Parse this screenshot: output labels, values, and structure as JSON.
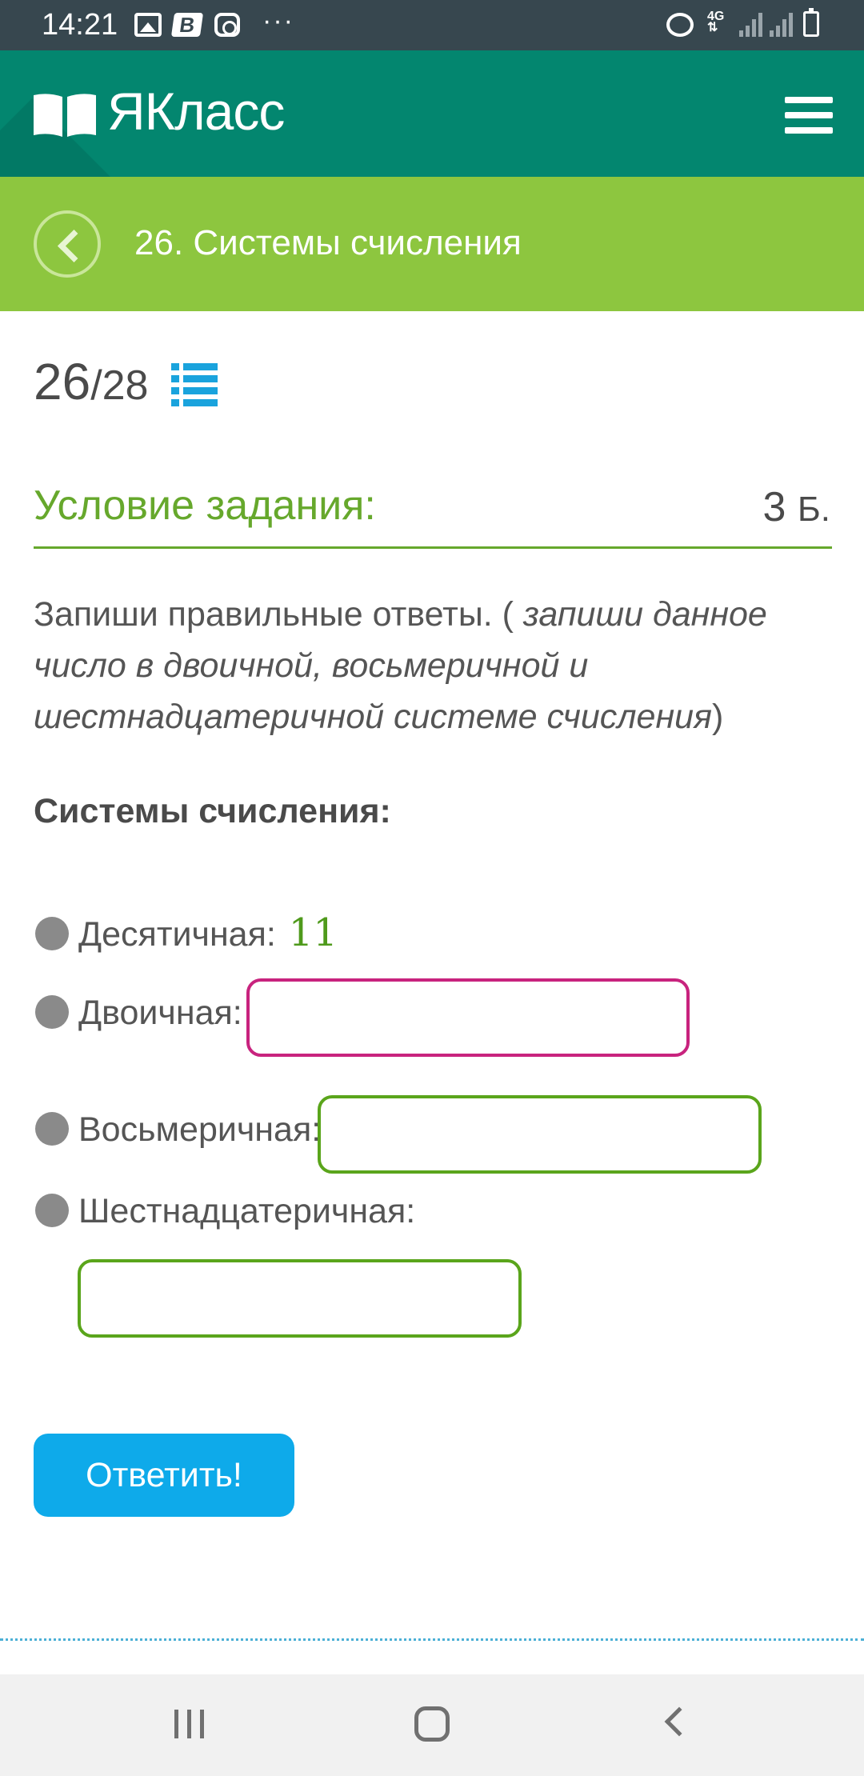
{
  "status_bar": {
    "time": "14:21",
    "network": "4G",
    "icons": [
      "gallery-icon",
      "b-icon",
      "instagram-icon",
      "more-icon",
      "alarm-icon",
      "network-4g-icon",
      "signal-icon",
      "signal-icon",
      "battery-charging-icon"
    ]
  },
  "header": {
    "logo_text": "ЯКласс",
    "menu_icon": "hamburger-menu-icon"
  },
  "titlebar": {
    "back_icon": "circle-back-icon",
    "title": "26. Системы счисления"
  },
  "progress": {
    "current": "26",
    "total": "/28",
    "icon": "list-icon"
  },
  "condition": {
    "title": "Условие задания:",
    "points_value": "3",
    "points_unit": "Б."
  },
  "task": {
    "text_plain": "Запиши правильные ответы. (",
    "text_italic": " запиши данное число в двоичной, восьмеричной и шестнадцатеричной системе счисления",
    "text_end": ")"
  },
  "systems": {
    "heading": "Системы счисления:",
    "decimal_label": "Десятичная:",
    "decimal_value": "11",
    "binary_label": "Двоичная:",
    "octal_label": "Восьмеричная:",
    "hex_label": "Шестнадцатеричная:"
  },
  "inputs": {
    "binary": "",
    "octal": "",
    "hex": ""
  },
  "colors": {
    "header_bg": "#03866f",
    "titlebar_bg": "#8dc63f",
    "accent_green": "#66a82c",
    "active_field_border": "#c8237e",
    "field_border": "#5aa51b",
    "button_bg": "#0eaaea"
  },
  "submit_label": "Ответить!",
  "nav": {
    "recent_icon": "recent-apps-icon",
    "home_icon": "home-icon",
    "back_icon": "back-icon"
  }
}
